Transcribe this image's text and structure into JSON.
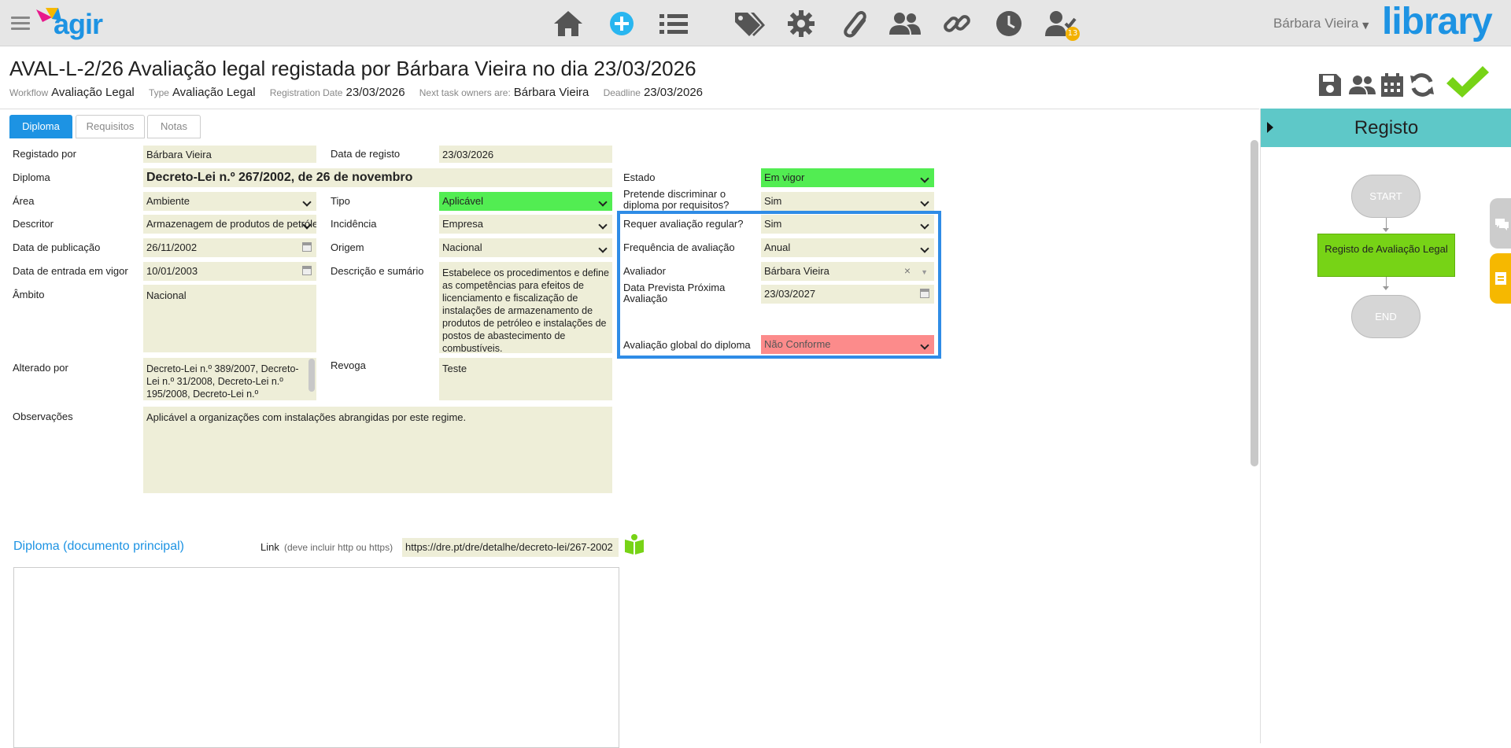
{
  "header": {
    "logo_text": "agir",
    "user_name": "Bárbara Vieira",
    "brand": "library",
    "notifications_count": "13",
    "icons": [
      "home-icon",
      "add-icon",
      "list-icon",
      "tags-icon",
      "gear-icon",
      "paperclip-icon",
      "users-icon",
      "link-icon",
      "clock-icon",
      "user-check-icon"
    ]
  },
  "record": {
    "title": "AVAL-L-2/26 Avaliação legal registada por Bárbara Vieira no dia 23/03/2026",
    "meta": {
      "workflow_label": "Workflow",
      "workflow": "Avaliação Legal",
      "type_label": "Type",
      "type": "Avaliação Legal",
      "regdate_label": "Registration Date",
      "regdate": "23/03/2026",
      "owners_label": "Next task owners are:",
      "owners": "Bárbara Vieira",
      "deadline_label": "Deadline",
      "deadline": "23/03/2026"
    }
  },
  "tabs": [
    "Diploma",
    "Requisitos",
    "Notas"
  ],
  "form": {
    "registado_por": {
      "label": "Registado por",
      "value": "Bárbara Vieira"
    },
    "data_registo": {
      "label": "Data de registo",
      "value": "23/03/2026"
    },
    "diploma": {
      "label": "Diploma",
      "value": "Decreto-Lei n.º 267/2002, de 26 de novembro"
    },
    "area": {
      "label": "Área",
      "value": "Ambiente"
    },
    "tipo": {
      "label": "Tipo",
      "value": "Aplicável"
    },
    "descritor": {
      "label": "Descritor",
      "value": "Armazenagem de produtos de petróleo"
    },
    "incidencia": {
      "label": "Incidência",
      "value": "Empresa"
    },
    "data_publicacao": {
      "label": "Data de publicação",
      "value": "26/11/2002"
    },
    "origem": {
      "label": "Origem",
      "value": "Nacional"
    },
    "data_entrada": {
      "label": "Data de entrada em vigor",
      "value": "10/01/2003"
    },
    "descricao": {
      "label": "Descrição e sumário",
      "value": "Estabelece os procedimentos e define as competências para efeitos de licenciamento e fiscalização de instalações de armazenamento de produtos de petróleo e instalações de postos de abastecimento de combustíveis."
    },
    "ambito": {
      "label": "Âmbito",
      "value": "Nacional"
    },
    "alterado_por": {
      "label": "Alterado por",
      "value": "Decreto-Lei n.º 389/2007, Decreto-Lei n.º 31/2008, Decreto-Lei n.º 195/2008, Decreto-Lei n.º"
    },
    "revoga": {
      "label": "Revoga",
      "value": "Teste"
    },
    "observacoes": {
      "label": "Observações",
      "value": "Aplicável a organizações com instalações abrangidas por este regime."
    },
    "estado": {
      "label": "Estado",
      "value": "Em vigor"
    },
    "discriminar": {
      "label": "Pretende discriminar o diploma por requisitos?",
      "value": "Sim"
    },
    "requer_avaliacao": {
      "label": "Requer avaliação regular?",
      "value": "Sim"
    },
    "frequencia": {
      "label": "Frequência de avaliação",
      "value": "Anual"
    },
    "avaliador": {
      "label": "Avaliador",
      "value": "Bárbara Vieira"
    },
    "data_prevista": {
      "label": "Data Prevista Próxima Avaliação",
      "value": "23/03/2027"
    },
    "avaliacao_global": {
      "label": "Avaliação global do diploma",
      "value": "Não Conforme"
    }
  },
  "document": {
    "title": "Diploma (documento principal)",
    "link_label": "Link",
    "link_hint": "(deve incluir http ou https)",
    "link_value": "https://dre.pt/dre/detalhe/decreto-lei/267-2002"
  },
  "sidebar": {
    "title": "Registo",
    "start": "START",
    "task": "Registo de Avaliação Legal",
    "end": "END"
  }
}
